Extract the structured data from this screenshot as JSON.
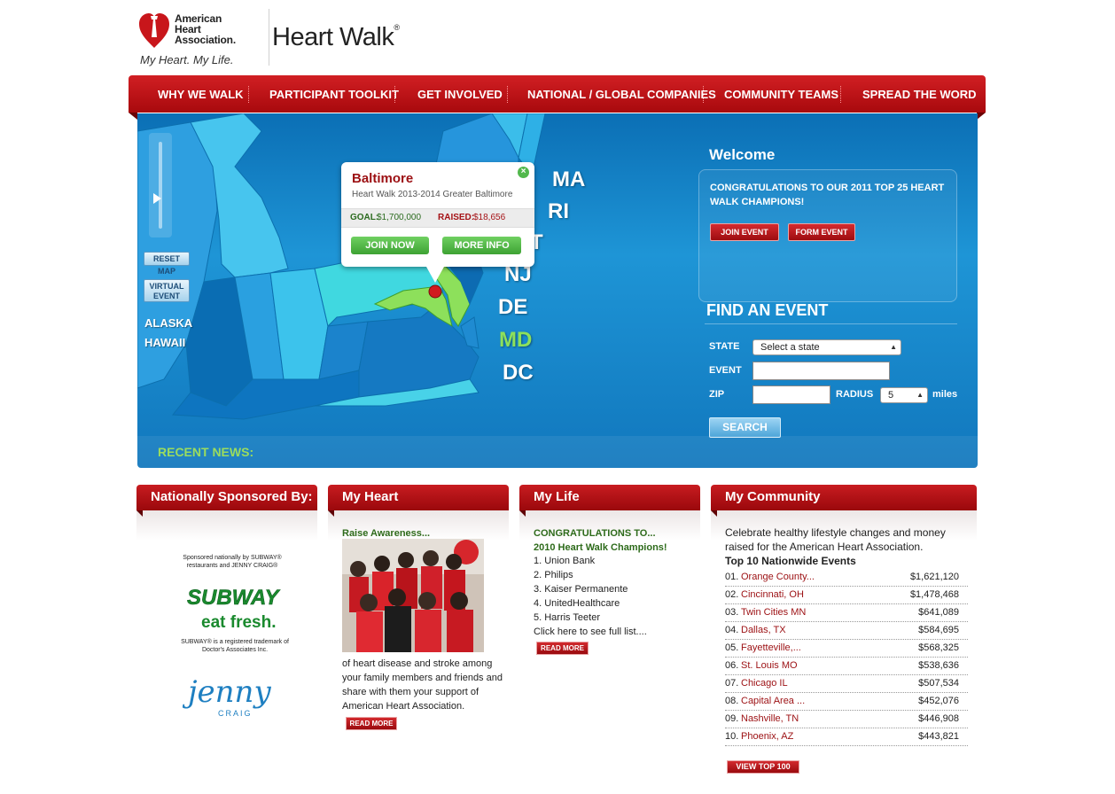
{
  "header": {
    "org_name_lines": [
      "American",
      "Heart",
      "Association."
    ],
    "tagline": "My Heart. My Life.",
    "program_title": "Heart Walk"
  },
  "nav": [
    "WHY WE WALK",
    "PARTICIPANT TOOLKIT",
    "GET INVOLVED",
    "NATIONAL / GLOBAL COMPANIES",
    "COMMUNITY TEAMS",
    "SPREAD THE WORD"
  ],
  "map": {
    "reset_label": "RESET MAP",
    "virtual_label": "VIRTUAL EVENT",
    "alaska_label": "ALASKA",
    "hawaii_label": "HAWAII",
    "state_labels": [
      "MA",
      "RI",
      "T",
      "NJ",
      "DE",
      "MD",
      "DC"
    ],
    "highlighted_state": "MD",
    "highlight_color": "#8de05b",
    "popup": {
      "title": "Baltimore",
      "subtitle": "Heart Walk 2013-2014 Greater Baltimore",
      "goal_label": "GOAL:",
      "goal_value": "$1,700,000",
      "raised_label": "RAISED:",
      "raised_value": "$18,656",
      "join_label": "JOIN NOW",
      "more_label": "MORE INFO"
    }
  },
  "welcome": {
    "title": "Welcome",
    "message": "CONGRATULATIONS TO OUR 2011 TOP 25 HEART WALK CHAMPIONS!",
    "join_event_label": "JOIN EVENT",
    "form_event_label": "FORM  EVENT"
  },
  "find_event": {
    "title": "FIND AN EVENT",
    "state_label": "STATE",
    "state_value": "Select a state",
    "event_label": "EVENT",
    "event_value": "",
    "zip_label": "ZIP",
    "zip_value": "",
    "radius_label": "RADIUS",
    "radius_value": "5",
    "miles_label": "miles",
    "search_label": "SEARCH"
  },
  "recent_news_label": "RECENT NEWS:",
  "sponsors": {
    "title": "Nationally Sponsored By:",
    "intro": "Sponsored nationally by SUBWAY® restaurants and JENNY CRAIG®",
    "subway_word": "SUBWAY",
    "subway_slogan": "eat fresh.",
    "subway_note": "SUBWAY® is a registered trademark of Doctor's Associates Inc.",
    "jenny_word": "jenny",
    "craig_word": "CRAIG"
  },
  "my_heart": {
    "title": "My Heart",
    "subtitle": "Raise Awareness...",
    "body": "of heart disease and stroke among your family members and friends and share with them your support of American Heart Association.",
    "read_more": "READ MORE"
  },
  "my_life": {
    "title": "My Life",
    "heading": "CONGRATULATIONS TO...",
    "subheading": "2010 Heart Walk Champions!",
    "champions": [
      "1. Union Bank",
      "2. Philips",
      "3. Kaiser Permanente",
      "4. UnitedHealthcare",
      "5. Harris Teeter"
    ],
    "full_list": "Click here to see full list....",
    "read_more": "READ MORE"
  },
  "my_community": {
    "title": "My Community",
    "intro": "Celebrate healthy lifestyle changes and money raised for the American Heart Association.",
    "list_title": "Top 10 Nationwide Events",
    "events": [
      {
        "rank": "01.",
        "name": "Orange County...",
        "amount": "$1,621,120"
      },
      {
        "rank": "02.",
        "name": "Cincinnati, OH",
        "amount": "$1,478,468"
      },
      {
        "rank": "03.",
        "name": "Twin Cities MN",
        "amount": "$641,089"
      },
      {
        "rank": "04.",
        "name": "Dallas, TX",
        "amount": "$584,695"
      },
      {
        "rank": "05.",
        "name": "Fayetteville,...",
        "amount": "$568,325"
      },
      {
        "rank": "06.",
        "name": "St. Louis MO",
        "amount": "$538,636"
      },
      {
        "rank": "07.",
        "name": "Chicago IL",
        "amount": "$507,534"
      },
      {
        "rank": "08.",
        "name": "Capital Area ...",
        "amount": "$452,076"
      },
      {
        "rank": "09.",
        "name": "Nashville, TN",
        "amount": "$446,908"
      },
      {
        "rank": "10.",
        "name": "Phoenix, AZ",
        "amount": "$443,821"
      }
    ],
    "view_top_label": "VIEW  TOP 100"
  }
}
